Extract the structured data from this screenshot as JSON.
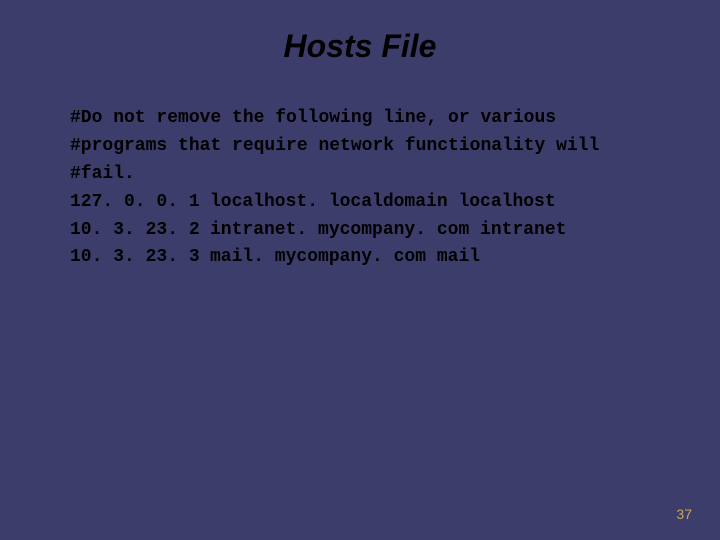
{
  "slide": {
    "title": "Hosts File",
    "comment_line1": "#Do not remove the following line, or various",
    "comment_line2": "#programs that require network functionality will",
    "comment_line3": "#fail.",
    "hosts": [
      {
        "ip": "127. 0. 0. 1",
        "names": "localhost. localdomain localhost"
      },
      {
        "ip": "10. 3. 23. 2",
        "names": "intranet. mycompany. com  intranet"
      },
      {
        "ip": "10. 3. 23. 3",
        "names": "mail. mycompany. com mail"
      }
    ],
    "page_number": "37"
  }
}
